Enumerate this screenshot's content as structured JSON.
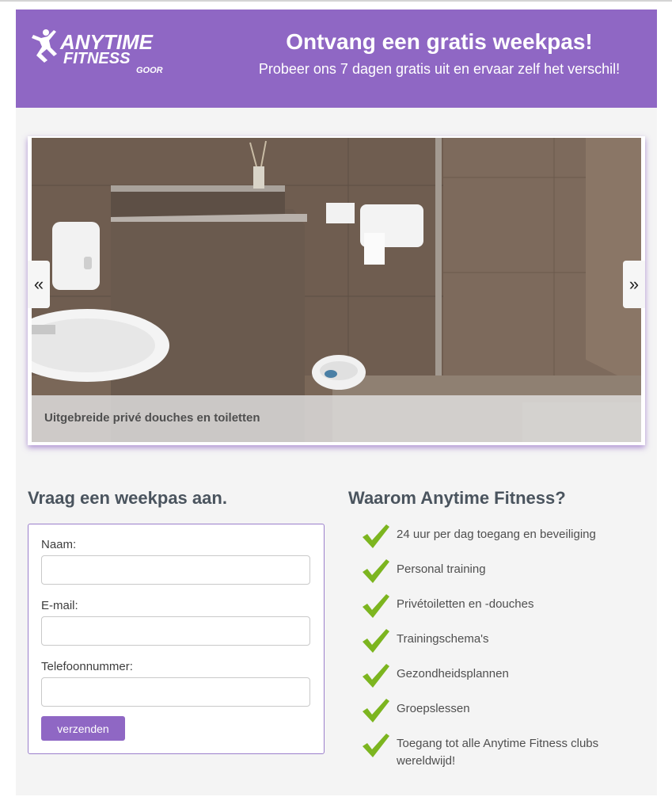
{
  "header": {
    "logo_line1": "ANYTIME",
    "logo_line2": "FITNESS",
    "logo_line3": "GOOR",
    "title": "Ontvang een gratis weekpas!",
    "subtitle": "Probeer ons 7 dagen gratis uit en ervaar zelf het verschil!"
  },
  "slider": {
    "prev_label": "«",
    "next_label": "»",
    "caption": "Uitgebreide privé douches en toiletten"
  },
  "form": {
    "heading": "Vraag een weekpas aan.",
    "name_label": "Naam:",
    "name_value": "",
    "email_label": "E-mail:",
    "email_value": "",
    "phone_label": "Telefoonnummer:",
    "phone_value": "",
    "submit_label": "verzenden"
  },
  "why": {
    "heading": "Waarom Anytime Fitness?",
    "items": [
      {
        "text": "24 uur per dag toegang en beveiliging",
        "icon": "check-icon"
      },
      {
        "text": "Personal training",
        "icon": "check-icon"
      },
      {
        "text": "Privétoiletten en -douches",
        "icon": "check-icon"
      },
      {
        "text": "Trainingschema's",
        "icon": "check-icon"
      },
      {
        "text": "Gezondheidsplannen",
        "icon": "check-icon"
      },
      {
        "text": "Groepslessen",
        "icon": "check-icon"
      },
      {
        "text": "Toegang tot alle Anytime Fitness clubs wereldwijd!",
        "icon": "check-icon"
      }
    ]
  },
  "colors": {
    "brand_purple": "#8f67c4",
    "check_green": "#7cb51f",
    "page_bg": "#f4f4f4"
  }
}
